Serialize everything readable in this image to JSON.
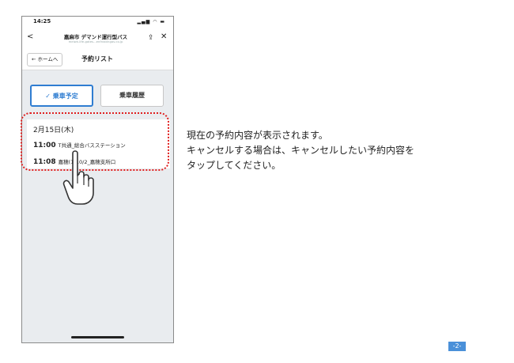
{
  "status_bar": {
    "time": "14:25",
    "icons": "signal wifi battery"
  },
  "nav": {
    "title": "嘉麻市 デマンド運行型バス",
    "url": "meiwk-life-gates...enfrostingas.co.jp"
  },
  "breadcrumb": {
    "home_label": "← ホームへ",
    "page_title": "予約リスト"
  },
  "tabs": [
    {
      "label": "✓ 乗車予定",
      "selected": true
    },
    {
      "label": "乗車履歴",
      "selected": false
    }
  ],
  "reservation": {
    "date": "2月15日(木)",
    "departure_time": "11:00",
    "departure_place": "T共通_総合バスステーション",
    "arrow": "+",
    "arrival_time": "11:08",
    "arrival_place": "嘉穂(1)10/2_嘉穂支所口"
  },
  "instructions": [
    "現在の予約内容が表示されます。",
    "キャンセルする場合は、キャンセルしたい予約内容を",
    "タップしてください。"
  ],
  "page_number": "-2-",
  "colors": {
    "accent": "#2f7dd1",
    "highlight": "#e02020",
    "page_badge": "#4a90d9"
  }
}
